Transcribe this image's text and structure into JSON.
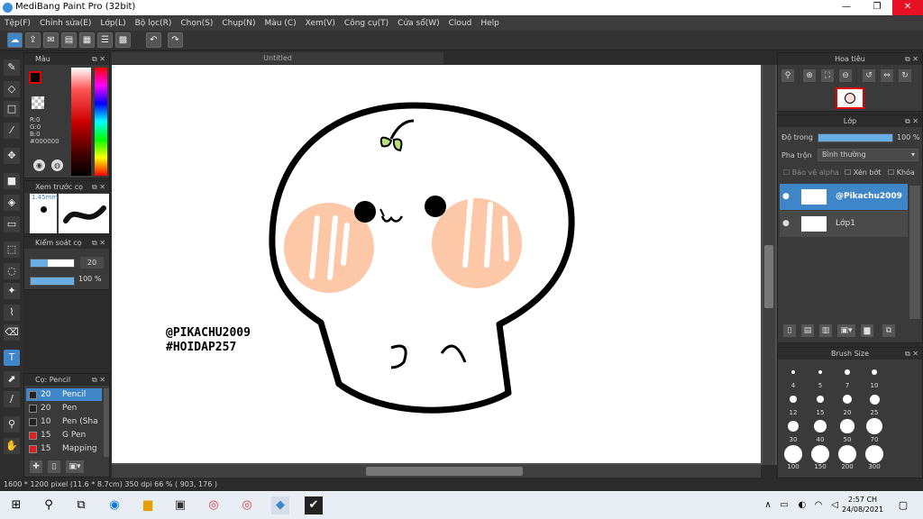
{
  "window": {
    "title": "MediBang Paint Pro (32bit)",
    "minimize": "—",
    "maximize": "❐",
    "close": "✕"
  },
  "menu": [
    "Tệp(F)",
    "Chỉnh sửa(E)",
    "Lớp(L)",
    "Bộ lọc(R)",
    "Chọn(S)",
    "Chụp(N)",
    "Màu (C)",
    "Xem(V)",
    "Công cụ(T)",
    "Cửa sổ(W)",
    "Cloud",
    "Help"
  ],
  "color_panel": {
    "title": "Màu",
    "r": "R:0",
    "g": "G:0",
    "b": "B:0",
    "hex": "#000000",
    "accent": "#e60000"
  },
  "brush_preview": {
    "title": "Xem trước cọ",
    "size": "1.45mm"
  },
  "brush_control": {
    "title": "Kiểm soát cọ",
    "size_value": "20",
    "opacity_value": "100 %"
  },
  "brush_panel": {
    "title": "Cọ: Pencil",
    "items": [
      {
        "size": "20",
        "name": "Pencil",
        "color": "#222222",
        "selected": true
      },
      {
        "size": "20",
        "name": "Pen",
        "color": "#222222",
        "selected": false
      },
      {
        "size": "10",
        "name": "Pen (Sha",
        "color": "#222222",
        "selected": false
      },
      {
        "size": "15",
        "name": "G Pen",
        "color": "#e02020",
        "selected": false
      },
      {
        "size": "15",
        "name": "Mapping",
        "color": "#e02020",
        "selected": false
      }
    ]
  },
  "document": {
    "tab": "Untitled",
    "watermark_line1": "@PIKACHU2009",
    "watermark_line2": "#HOIDAP257"
  },
  "navigator": {
    "title": "Hoa tiêu"
  },
  "layer_panel": {
    "title": "Lớp",
    "opacity_label": "Độ trong",
    "opacity_value": "100 %",
    "blend_label": "Pha trộn",
    "blend_value": "Bình thường",
    "protect_alpha": "Bảo vệ alpha",
    "clipping": "Xén bớt",
    "lock": "Khóa",
    "layers": [
      {
        "name": "@Pikachu2009",
        "selected": true
      },
      {
        "name": "Lớp1",
        "selected": false
      }
    ]
  },
  "brush_size": {
    "title": "Brush Size",
    "sizes": [
      "4",
      "5",
      "7",
      "10",
      "12",
      "15",
      "20",
      "25",
      "30",
      "40",
      "50",
      "70",
      "100",
      "150",
      "200",
      "300"
    ]
  },
  "status": "1600 * 1200 pixel   (11.6 * 8.7cm)   350 dpi   66 %   ( 903, 176 )",
  "taskbar": {
    "time": "2:57 CH",
    "date": "24/08/2021"
  }
}
